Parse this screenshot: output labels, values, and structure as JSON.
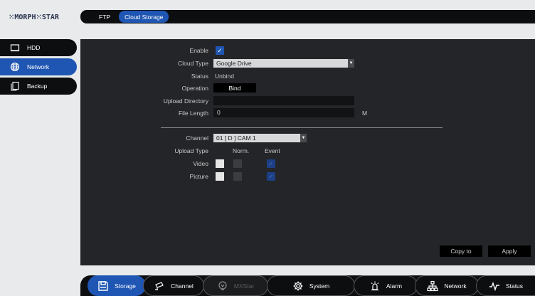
{
  "brand": {
    "logo_text": "⁙MORPH⁙STAR"
  },
  "top_tabs": [
    {
      "label": "FTP",
      "active": false
    },
    {
      "label": "Cloud Storage",
      "active": true
    }
  ],
  "left_menu": [
    {
      "label": "HDD",
      "icon": "hdd-icon",
      "active": false
    },
    {
      "label": "Network",
      "icon": "globe-icon",
      "active": true
    },
    {
      "label": "Backup",
      "icon": "backup-icon",
      "active": false
    }
  ],
  "form": {
    "enable_label": "Enable",
    "enable_checked": true,
    "cloud_type_label": "Cloud Type",
    "cloud_type_value": "Google Drive",
    "status_label": "Status",
    "status_value": "Unbind",
    "operation_label": "Operation",
    "bind_button": "Bind",
    "upload_dir_label": "Upload Directory",
    "upload_dir_value": "",
    "file_length_label": "File Length",
    "file_length_value": "0",
    "file_length_unit": "M",
    "channel_label": "Channel",
    "channel_value": "01 [ D ] CAM 1",
    "upload_type_label": "Upload Type",
    "col_norm": "Norm.",
    "col_event": "Event",
    "video_label": "Video",
    "picture_label": "Picture",
    "checkmark": "✓"
  },
  "buttons": {
    "copy_to": "Copy to",
    "apply": "Apply"
  },
  "bottom_nav": [
    {
      "label": "Storage",
      "icon": "save-icon",
      "state": "active"
    },
    {
      "label": "Channel",
      "icon": "camera-icon",
      "state": "normal"
    },
    {
      "label": "MXStar",
      "icon": "mxstar-icon",
      "state": "disabled"
    },
    {
      "label": "System",
      "icon": "gear-icon",
      "state": "normal"
    },
    {
      "label": "Alarm",
      "icon": "alarm-icon",
      "state": "normal"
    },
    {
      "label": "Network",
      "icon": "network-icon",
      "state": "normal"
    },
    {
      "label": "Status",
      "icon": "pulse-icon",
      "state": "normal"
    }
  ],
  "colors": {
    "accent": "#1f56b4",
    "panel": "#242528",
    "bar": "#0d0e10",
    "background": "#e8eaec"
  }
}
